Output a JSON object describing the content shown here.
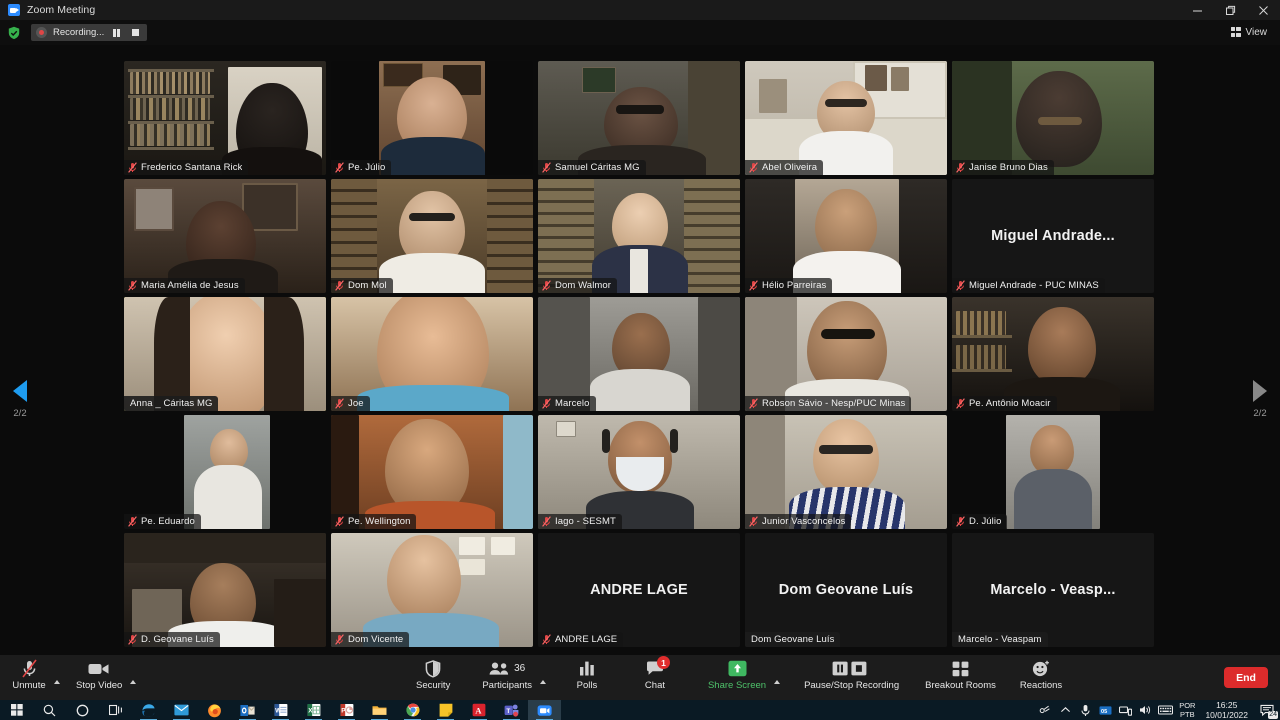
{
  "window": {
    "title": "Zoom Meeting",
    "app_icon": "zoom-icon",
    "minimize_label": "Minimize",
    "restore_label": "Restore",
    "close_label": "Close"
  },
  "appbar": {
    "shield_icon": "shield-check-icon",
    "recording_label": "Recording...",
    "pause_label": "Pause recording",
    "stop_label": "Stop recording",
    "view_label": "View",
    "view_icon": "grid-view-icon"
  },
  "pager": {
    "prev_icon": "chevron-left-icon",
    "next_icon": "chevron-right-icon",
    "left_page": "2/2",
    "right_page": "2/2"
  },
  "gallery": {
    "tiles": [
      {
        "name": "Frederico Santana Rick",
        "muted": true,
        "speaking": false,
        "avatar": false,
        "art": "bookshelf-dark"
      },
      {
        "name": "Pe. Júlio",
        "muted": true,
        "speaking": false,
        "avatar": false,
        "art": "office-pillar"
      },
      {
        "name": "Samuel Cáritas MG",
        "muted": true,
        "speaking": false,
        "avatar": false,
        "art": "room-dim"
      },
      {
        "name": "Abel Oliveira",
        "muted": true,
        "speaking": false,
        "avatar": false,
        "art": "bright-room"
      },
      {
        "name": "Janise Bruno Dias",
        "muted": true,
        "speaking": false,
        "avatar": false,
        "art": "green-room"
      },
      {
        "name": "Maria Amélia de Jesus",
        "muted": true,
        "speaking": false,
        "avatar": false,
        "art": "mirror-room"
      },
      {
        "name": "Dom Mol",
        "muted": true,
        "speaking": false,
        "avatar": false,
        "art": "library-warm"
      },
      {
        "name": "Dom Walmor",
        "muted": true,
        "speaking": false,
        "avatar": false,
        "art": "library-books"
      },
      {
        "name": "Hélio Parreiras",
        "muted": true,
        "speaking": false,
        "avatar": false,
        "art": "plain-light"
      },
      {
        "name": "Miguel Andrade - PUC MINAS",
        "muted": false,
        "speaking": false,
        "avatar": true,
        "avatar_text": "Miguel  Andrade...",
        "art": "none"
      },
      {
        "name": "Anna _ Cáritas MG",
        "muted": false,
        "speaking": true,
        "avatar": false,
        "art": "closeup-woman"
      },
      {
        "name": "Joe",
        "muted": true,
        "speaking": false,
        "avatar": false,
        "art": "closeup-man"
      },
      {
        "name": "Marcelo",
        "muted": true,
        "speaking": false,
        "avatar": false,
        "art": "grey-room"
      },
      {
        "name": "Robson Sávio - Nesp/PUC Minas",
        "muted": true,
        "speaking": false,
        "avatar": false,
        "art": "white-wall"
      },
      {
        "name": "Pe. Antônio Moacir",
        "muted": true,
        "speaking": false,
        "avatar": false,
        "art": "dark-shelf"
      },
      {
        "name": "Pe. Eduardo",
        "muted": true,
        "speaking": false,
        "avatar": false,
        "art": "narrow-center"
      },
      {
        "name": "Pe. Wellington",
        "muted": true,
        "speaking": false,
        "avatar": false,
        "art": "orange-room"
      },
      {
        "name": "Iago - SESMT",
        "muted": true,
        "speaking": false,
        "avatar": false,
        "art": "mask-headset"
      },
      {
        "name": "Junior Vasconcelos",
        "muted": true,
        "speaking": false,
        "avatar": false,
        "art": "glasses-stripes"
      },
      {
        "name": "D. Júlio",
        "muted": true,
        "speaking": false,
        "avatar": false,
        "art": "narrow-grey"
      },
      {
        "name": "D. Geovane Luís",
        "muted": true,
        "speaking": false,
        "avatar": false,
        "art": "desk-office"
      },
      {
        "name": "Dom Vicente",
        "muted": true,
        "speaking": false,
        "avatar": false,
        "art": "wall-notes"
      },
      {
        "name": "ANDRE LAGE",
        "muted": true,
        "speaking": false,
        "avatar": true,
        "avatar_text": "ANDRE LAGE",
        "art": "none"
      },
      {
        "name": "Dom Geovane Luís",
        "muted": false,
        "speaking": false,
        "avatar": true,
        "avatar_text": "Dom Geovane Luís",
        "art": "none"
      },
      {
        "name": "Marcelo - Veaspam",
        "muted": false,
        "speaking": false,
        "avatar": true,
        "avatar_text": "Marcelo - Veasp...",
        "art": "none"
      }
    ]
  },
  "toolbar": {
    "mute": {
      "label": "Unmute",
      "icon": "microphone-muted-icon"
    },
    "video": {
      "label": "Stop Video",
      "icon": "camera-icon"
    },
    "security": {
      "label": "Security",
      "icon": "shield-icon"
    },
    "participants": {
      "label": "Participants",
      "icon": "participants-icon",
      "count": "36"
    },
    "polls": {
      "label": "Polls",
      "icon": "bar-chart-icon"
    },
    "chat": {
      "label": "Chat",
      "icon": "chat-bubble-icon",
      "badge": "1"
    },
    "share": {
      "label": "Share Screen",
      "icon": "share-screen-icon",
      "color": "#4ec26a"
    },
    "recording": {
      "label": "Pause/Stop Recording",
      "pause_icon": "pause-icon",
      "stop_icon": "stop-icon"
    },
    "breakout": {
      "label": "Breakout Rooms",
      "icon": "breakout-rooms-icon"
    },
    "reactions": {
      "label": "Reactions",
      "icon": "reactions-smiley-icon"
    },
    "end": {
      "label": "End",
      "color": "#dc2b2b"
    }
  },
  "taskbar": {
    "items": [
      {
        "name": "start-button",
        "icon": "windows-logo-icon"
      },
      {
        "name": "search-button",
        "icon": "search-icon"
      },
      {
        "name": "cortana-button",
        "icon": "circle-icon"
      },
      {
        "name": "task-view-button",
        "icon": "task-view-icon"
      },
      {
        "name": "edge-legacy",
        "icon": "edge-icon"
      },
      {
        "name": "mail",
        "icon": "mail-icon"
      },
      {
        "name": "firefox",
        "icon": "firefox-icon"
      },
      {
        "name": "outlook",
        "icon": "outlook-icon"
      },
      {
        "name": "word",
        "icon": "word-icon"
      },
      {
        "name": "excel",
        "icon": "excel-icon"
      },
      {
        "name": "powerpoint",
        "icon": "powerpoint-icon"
      },
      {
        "name": "file-explorer",
        "icon": "folder-icon"
      },
      {
        "name": "chrome",
        "icon": "chrome-icon"
      },
      {
        "name": "sticky-notes",
        "icon": "note-icon"
      },
      {
        "name": "acrobat-reader",
        "icon": "pdf-icon"
      },
      {
        "name": "microsoft-teams",
        "icon": "teams-icon"
      },
      {
        "name": "zoom",
        "icon": "zoom-icon"
      }
    ],
    "tray": {
      "pen_icon": "pen-icon",
      "overflow_icon": "chevron-up-icon",
      "onedrive_icon": "onedrive-icon",
      "office_icon": "office-icon",
      "network_icon": "network-icon",
      "volume_icon": "speaker-icon",
      "keyboard_icon": "keyboard-icon",
      "language_line1": "POR",
      "language_line2": "PTB",
      "time": "16:25",
      "date": "10/01/2022",
      "notification_icon": "action-center-icon",
      "notification_count": "24"
    }
  }
}
